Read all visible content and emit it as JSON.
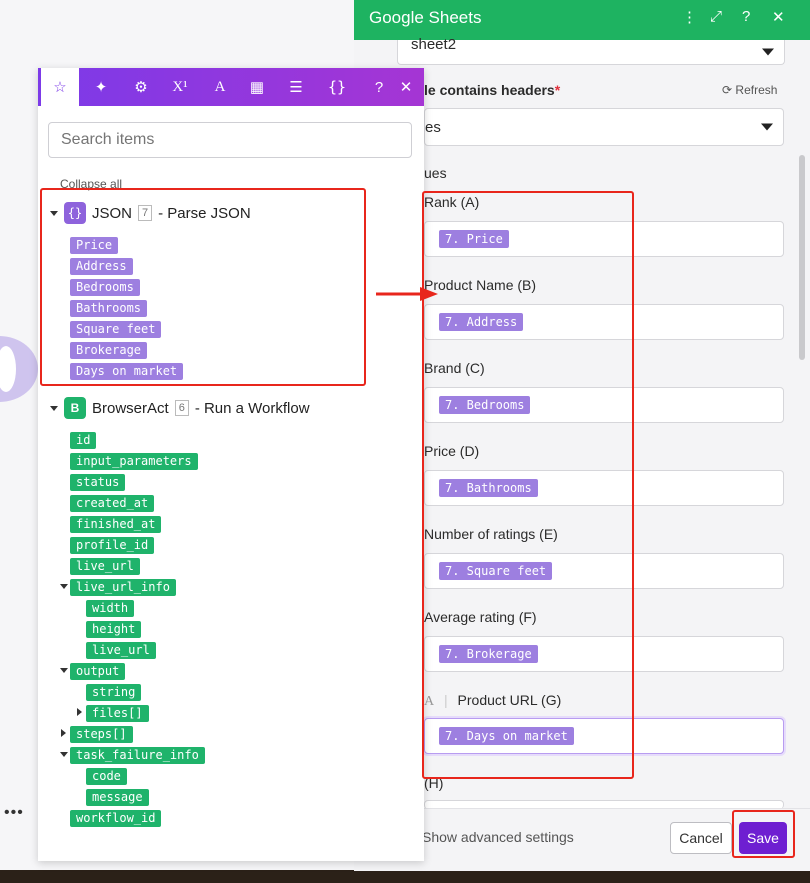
{
  "right_panel": {
    "title": "Google Sheets",
    "sheet_value": "sheet2",
    "headers_label": "le contains headers",
    "required_mark": "*",
    "refresh_label": "Refresh",
    "headers_value": "es",
    "values_label": "ues",
    "fields": [
      {
        "label": "Rank (A)",
        "token": "7. Price"
      },
      {
        "label": "Product Name (B)",
        "token": "7. Address"
      },
      {
        "label": "Brand (C)",
        "token": "7. Bedrooms"
      },
      {
        "label": "Price (D)",
        "token": "7. Bathrooms"
      },
      {
        "label": "Number of ratings (E)",
        "token": "7. Square feet"
      },
      {
        "label": "Average rating (F)",
        "token": "7. Brokerage"
      },
      {
        "label": "Product URL (G)",
        "token": "7. Days on market"
      }
    ],
    "next_label": "(H)",
    "show_advanced": "Show advanced settings",
    "cancel_label": "Cancel",
    "save_label": "Save",
    "header_color": "#1eb361",
    "save_color": "#6e1fd1"
  },
  "picker": {
    "search_placeholder": "Search items",
    "collapse_all": "Collapse all",
    "json_module": {
      "name": "JSON",
      "num": "7",
      "action": "- Parse JSON",
      "items": [
        "Price",
        "Address",
        "Bedrooms",
        "Bathrooms",
        "Square feet",
        "Brokerage",
        "Days on market"
      ]
    },
    "browseract_module": {
      "name": "BrowserAct",
      "num": "6",
      "action": "- Run a Workflow",
      "items": {
        "id": "id",
        "input_parameters": "input_parameters",
        "status": "status",
        "created_at": "created_at",
        "finished_at": "finished_at",
        "profile_id": "profile_id",
        "live_url": "live_url",
        "live_url_info": "live_url_info",
        "width": "width",
        "height": "height",
        "live_url2": "live_url",
        "output": "output",
        "string": "string",
        "files": "files[]",
        "steps": "steps[]",
        "task_failure_info": "task_failure_info",
        "code": "code",
        "message": "message",
        "workflow_id": "workflow_id"
      }
    }
  }
}
